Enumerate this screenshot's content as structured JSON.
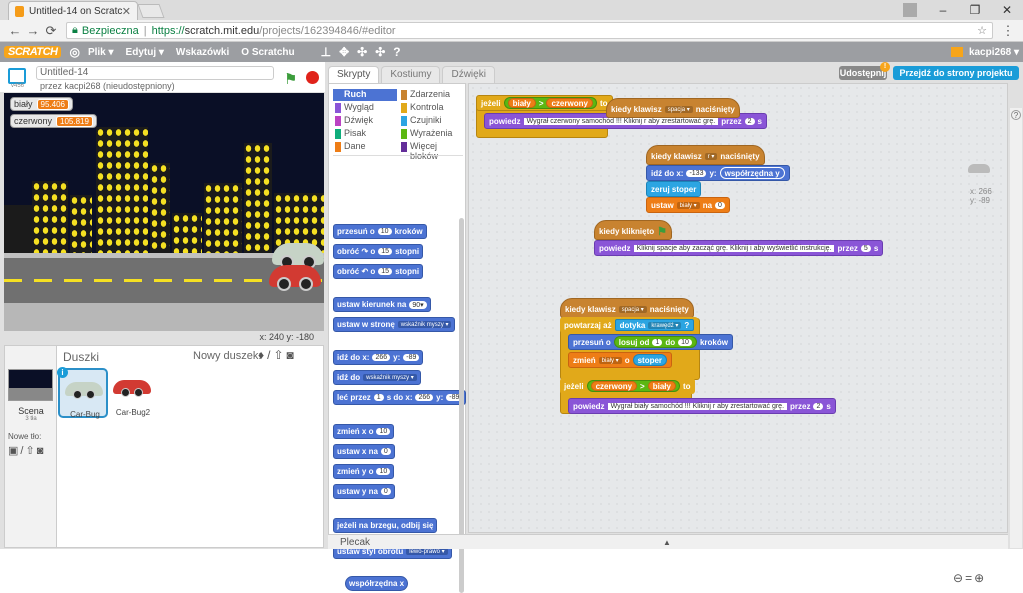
{
  "browser": {
    "tab_title": "Untitled-14 on Scratch",
    "security_label": "Bezpieczna",
    "url_proto": "https://",
    "url_host": "scratch.mit.edu",
    "url_path": "/projects/162394846/#editor"
  },
  "menubar": {
    "logo": "SCRATCH",
    "items": [
      "Plik ▾",
      "Edytuj ▾",
      "Wskazówki",
      "O Scratchu"
    ],
    "username": "kacpi268 ▾"
  },
  "stage": {
    "project_title": "Untitled-14",
    "byline": "przez kacpi268 (nieudostępniony)",
    "version": "v456",
    "monitors": [
      {
        "label": "biały",
        "value": "95.406"
      },
      {
        "label": "czerwony",
        "value": "105.819"
      }
    ],
    "coords": "x: 240  y: -180"
  },
  "sprites": {
    "title": "Duszki",
    "new_sprite_label": "Nowy duszek:",
    "stage_label": "Scena",
    "stage_sub": "3 tła",
    "new_backdrop_label": "Nowe tło:",
    "items": [
      {
        "name": "Car-Bug",
        "color": "#9aa99a"
      },
      {
        "name": "Car-Bug2",
        "color": "#d23a32"
      }
    ]
  },
  "palette": {
    "tabs": [
      "Skrypty",
      "Kostiumy",
      "Dźwięki"
    ],
    "categories": [
      {
        "label": "Ruch",
        "color": "#4c73d3"
      },
      {
        "label": "Wygląd",
        "color": "#8a55d7"
      },
      {
        "label": "Dźwięk",
        "color": "#bb42c3"
      },
      {
        "label": "Pisak",
        "color": "#0fad7b"
      },
      {
        "label": "Dane",
        "color": "#ee7d16"
      },
      {
        "label": "Zdarzenia",
        "color": "#c88330"
      },
      {
        "label": "Kontrola",
        "color": "#e1a91a"
      },
      {
        "label": "Czujniki",
        "color": "#2ca5e2"
      },
      {
        "label": "Wyrażenia",
        "color": "#5cb712"
      },
      {
        "label": "Więcej bloków",
        "color": "#632d99"
      }
    ],
    "blocks": [
      {
        "pre": "przesuń o",
        "n": "10",
        "post": "kroków"
      },
      {
        "pre": "obróć ↷ o",
        "n": "15",
        "post": "stopni"
      },
      {
        "pre": "obróć ↶ o",
        "n": "15",
        "post": "stopni"
      },
      {
        "pre": "ustaw kierunek na",
        "n": "90▾",
        "post": ""
      },
      {
        "pre": "ustaw w stronę",
        "dd": "wskaźnik myszy ▾",
        "post": ""
      },
      {
        "pre": "idź do x:",
        "n": "266",
        "mid": "y:",
        "n2": "-89"
      },
      {
        "pre": "idź do",
        "dd": "wskaźnik myszy ▾",
        "post": ""
      },
      {
        "pre": "leć przez",
        "n": "1",
        "mid": "s do x:",
        "n2": "266",
        "mid2": "y:",
        "n3": "-89"
      },
      {
        "pre": "zmień x o",
        "n": "10",
        "post": ""
      },
      {
        "pre": "ustaw x na",
        "n": "0",
        "post": ""
      },
      {
        "pre": "zmień y o",
        "n": "10",
        "post": ""
      },
      {
        "pre": "ustaw y na",
        "n": "0",
        "post": ""
      },
      {
        "pre": "jeżeli na brzegu, odbij się",
        "post": ""
      },
      {
        "pre": "ustaw styl obrotu",
        "dd": "lewo-prawo ▾",
        "post": ""
      },
      {
        "pre": "współrzędna x",
        "post": ""
      }
    ]
  },
  "topright": {
    "share_label": "Udostępnij",
    "go_project_label": "Przejdź do strony projektu"
  },
  "scripts": {
    "s1": {
      "if": "jeżeli",
      "biały": "biały",
      "gt": ">",
      "czerwony": "czerwony",
      "to": "to",
      "say": "powiedz",
      "say_text": "Wygrał czerwony samochód !!! Kliknij r aby zrestartować grę.",
      "przez": "przez",
      "n": "2",
      "s": "s"
    },
    "s2": {
      "hat": "kiedy klawisz",
      "key": "spacja ▾",
      "hat2": "naciśnięty"
    },
    "s3": {
      "hat": "kiedy klawisz",
      "key": "r ▾",
      "hat2": "naciśnięty",
      "goto": "idź do x:",
      "x": "-133",
      "y": "y:",
      "yval": "współrzędna y",
      "stop": "zeruj stoper",
      "set": "ustaw",
      "var": "biały ▾",
      "na": "na",
      "val": "0"
    },
    "s4": {
      "hat": "kiedy kliknięto",
      "say": "powiedz",
      "say_text": "Kliknij spacje aby zacząć grę. Kliknij i aby wyświetlić instrukcję.",
      "przez": "przez",
      "n": "5",
      "s": "s"
    },
    "s5": {
      "hat": "kiedy klawisz",
      "key": "spacja ▾",
      "hat2": "naciśnięty",
      "repeat": "powtarzaj aż",
      "touching": "dotyka",
      "edge": "krawędź ▾",
      "q": "?",
      "move": "przesuń o",
      "rand": "losuj od",
      "r1": "1",
      "do": "do",
      "r2": "10",
      "steps": "kroków",
      "change": "zmień",
      "var": "biały ▾",
      "o": "o",
      "timer": "stoper",
      "if": "jeżeli",
      "czerwony": "czerwony",
      "gt": ">",
      "biały": "biały",
      "to": "to",
      "say": "powiedz",
      "say_text": "Wygrał biały samochód !!! Kliknij r aby zrestartować grę.",
      "przez": "przez",
      "n": "2",
      "s": "s"
    }
  },
  "sprite_info": {
    "x": "x: 266",
    "y": "y: -89"
  },
  "backpack": "Plecak"
}
